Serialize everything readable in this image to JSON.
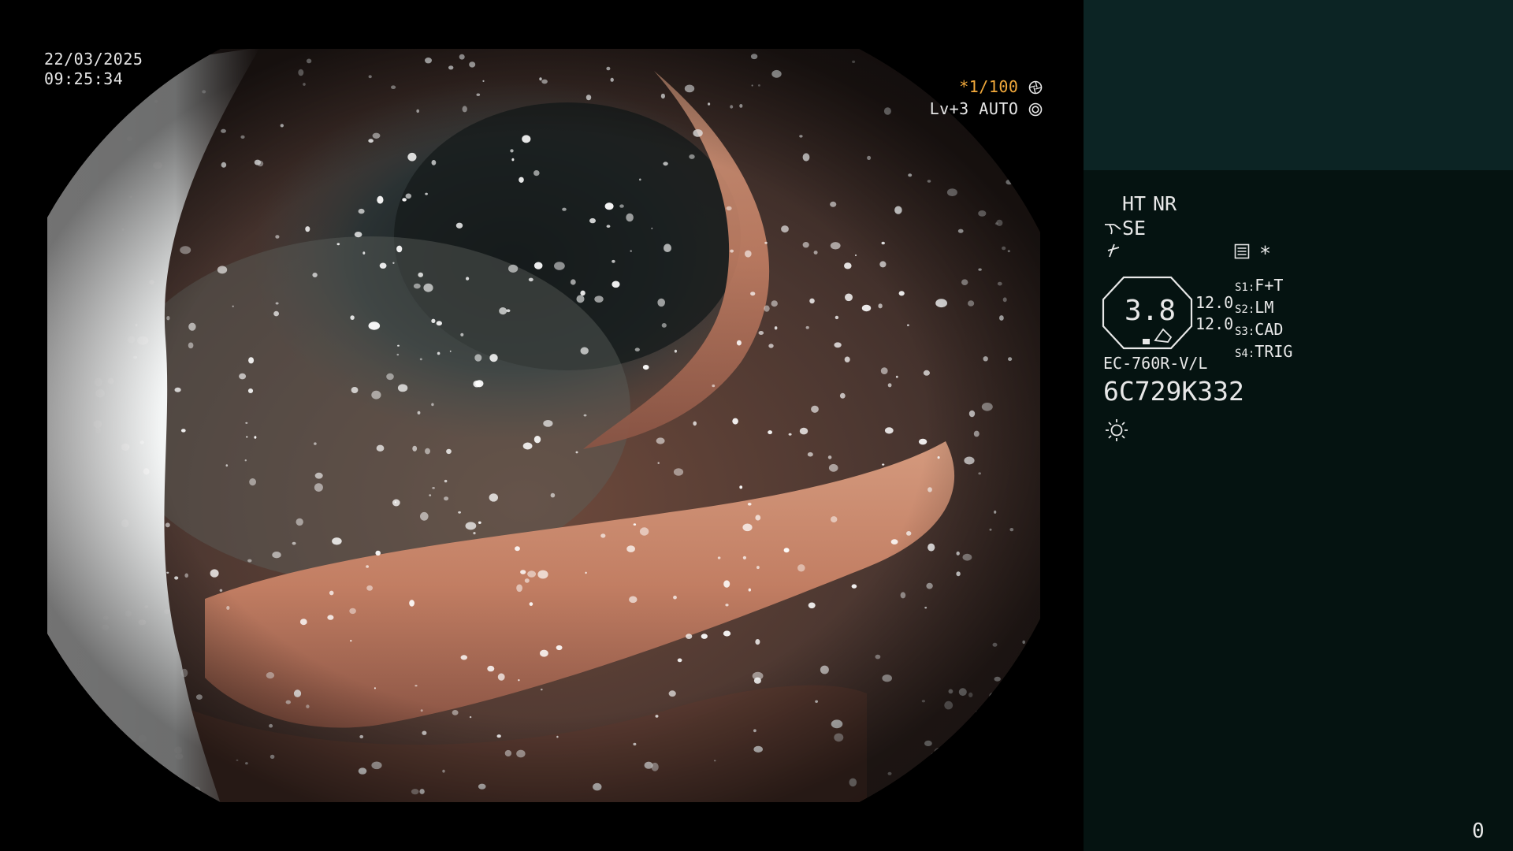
{
  "overlay": {
    "date": "22/03/2025",
    "time": "09:25:34",
    "shutter": "*1/100",
    "level": "Lv+3",
    "iris_mode": "AUTO"
  },
  "panel": {
    "ht_label": "HT",
    "nr_label": "NR",
    "se_label": "SE",
    "asterisk": "*",
    "zoom_value": "3.8",
    "value_top": "12.0",
    "value_bottom": "12.0",
    "switches": [
      {
        "key": "S1:",
        "value": "F+T"
      },
      {
        "key": "S2:",
        "value": "LM"
      },
      {
        "key": "S3:",
        "value": "CAD"
      },
      {
        "key": "S4:",
        "value": "TRIG"
      }
    ],
    "scope_model": "EC-760R-V/L",
    "serial": "6C729K332",
    "counter": "0"
  },
  "colors": {
    "amber": "#f2a93b",
    "panel_top": "#0c2424",
    "panel_bottom": "#051311",
    "text": "#e8e8e8"
  },
  "icons": [
    "aperture-icon",
    "iris-icon",
    "scope-angle-icon",
    "enhance-icon",
    "menu-list-icon",
    "zoom-octagon-icon",
    "light-icon"
  ]
}
